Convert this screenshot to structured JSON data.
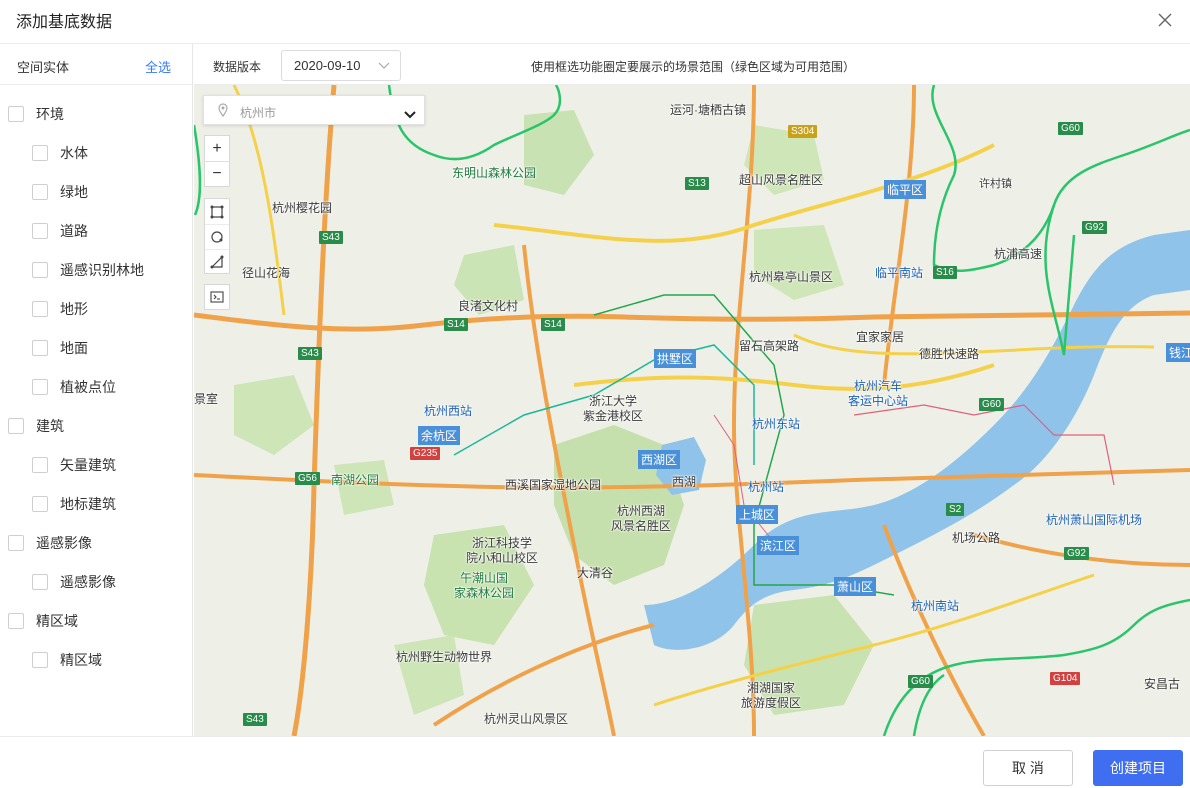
{
  "dialog": {
    "title": "添加基底数据"
  },
  "sidebar": {
    "header_label": "空间实体",
    "select_all": "全选",
    "groups": [
      {
        "label": "环境",
        "children": [
          "水体",
          "绿地",
          "道路",
          "遥感识别林地",
          "地形",
          "地面",
          "植被点位"
        ]
      },
      {
        "label": "建筑",
        "children": [
          "矢量建筑",
          "地标建筑"
        ]
      },
      {
        "label": "遥感影像",
        "children": [
          "遥感影像"
        ]
      },
      {
        "label": "精区域",
        "children": [
          "精区域"
        ]
      }
    ]
  },
  "toolbar": {
    "version_label": "数据版本",
    "version_value": "2020-09-10",
    "hint": "使用框选功能圈定要展示的场景范围（绿色区域为可用范围）"
  },
  "map": {
    "city_search": {
      "value": "杭州市"
    },
    "zoom_in": "+",
    "zoom_out": "−",
    "labels": {
      "yunhe": "运河·塘栖古镇",
      "dongming": "东明山森林公园",
      "chaoshan": "超山风景名胜区",
      "linping": "临平区",
      "xuqiao": "许村镇",
      "yinghua": "杭州樱花园",
      "jingshan": "径山花海",
      "liangzhu": "良渚文化村",
      "gaoting": "杭州皋亭山景区",
      "linpingnan": "临平南站",
      "hangpu": "杭浦高速",
      "yijia": "宜家家居",
      "gongshu": "拱墅区",
      "zheda": "浙江大学\n紫金港校区",
      "qiche": "杭州汽车\n客运中心站",
      "hzwest": "杭州西站",
      "yuhang": "余杭区",
      "dongzhan": "杭州东站",
      "xihuqu": "西湖区",
      "nanhu": "南湖公园",
      "xixi": "西溪国家湿地公园",
      "hzstation": "杭州站",
      "xihu": "西湖",
      "westlake": "杭州西湖\n风景名胜区",
      "shangcheng": "上城区",
      "airport": "杭州萧山国际机场",
      "zhekeji": "浙江科技学\n院小和山校区",
      "dq": "大清谷",
      "binjiang": "滨江区",
      "wuchao": "午潮山国\n家森林公园",
      "xiaoshan": "萧山区",
      "hznan": "杭州南站",
      "dongwu": "杭州野生动物世界",
      "xianghu": "湘湖国家\n旅游度假区",
      "lingshan": "杭州灵山风景区",
      "anji": "安昌古",
      "deshengkuai": "德胜快速路",
      "liushi": "留石高架路",
      "jichang": "机场公路",
      "qianjiang": "钱江",
      "jingshi": "景室"
    },
    "roads": [
      "S304",
      "S13",
      "S43",
      "S14",
      "S14",
      "S43",
      "G235",
      "G56",
      "S16",
      "G60",
      "G92",
      "G60",
      "S2",
      "G92",
      "G60",
      "G104",
      "S43"
    ]
  },
  "footer": {
    "cancel": "取 消",
    "create": "创建项目"
  }
}
